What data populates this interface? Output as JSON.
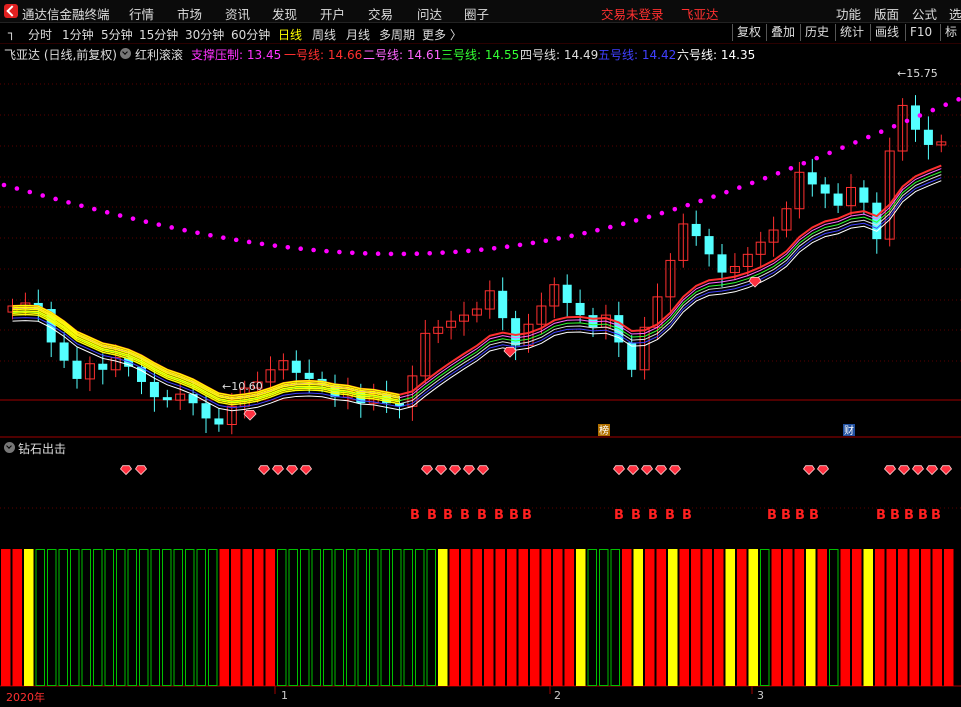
{
  "menubar": {
    "app_title": "通达信金融终端",
    "items": [
      "行情",
      "市场",
      "资讯",
      "发现",
      "开户",
      "交易",
      "问达",
      "圈子"
    ],
    "login_status": "交易未登录",
    "stock_name": "飞亚达",
    "right_items": [
      "功能",
      "版面",
      "公式",
      "选"
    ]
  },
  "toolbar": {
    "periods": [
      "分时",
      "1分钟",
      "5分钟",
      "15分钟",
      "30分钟",
      "60分钟",
      "日线",
      "周线",
      "月线",
      "多周期",
      "更多 〉"
    ],
    "active_period": "日线",
    "right_buttons": [
      "复权",
      "叠加",
      "历史",
      "统计",
      "画线",
      "F10",
      "标"
    ]
  },
  "main_chart": {
    "title": "飞亚达 (日线,前复权)",
    "indicator_name": "红利滚滚",
    "lines": [
      {
        "label": "支撑压制: 13.45",
        "color": "#ff33ff"
      },
      {
        "label": "一号线: 14.66",
        "color": "#ff3030"
      },
      {
        "label": "二号线: 14.61",
        "color": "#ff66ff"
      },
      {
        "label": "三号线: 14.55",
        "color": "#33ff33"
      },
      {
        "label": "四号线: 14.49",
        "color": "#dddddd"
      },
      {
        "label": "五号线: 14.42",
        "color": "#4040ff"
      },
      {
        "label": "六号线: 14.35",
        "color": "#ffffff"
      }
    ],
    "high_label": "15.75",
    "low_label": "10.60",
    "event_tags": [
      "榜",
      "财"
    ]
  },
  "indicator_panel": {
    "title": "钻石出击",
    "buy_marker": "B"
  },
  "time_axis": [
    "2020年",
    "1",
    "2",
    "3"
  ],
  "colors": {
    "up": "#ff3030",
    "down": "#54ffff",
    "bar_red": "#ff0000",
    "bar_yellow": "#ffff00",
    "bar_green": "#00c000",
    "dots": "#ff00ff"
  }
}
